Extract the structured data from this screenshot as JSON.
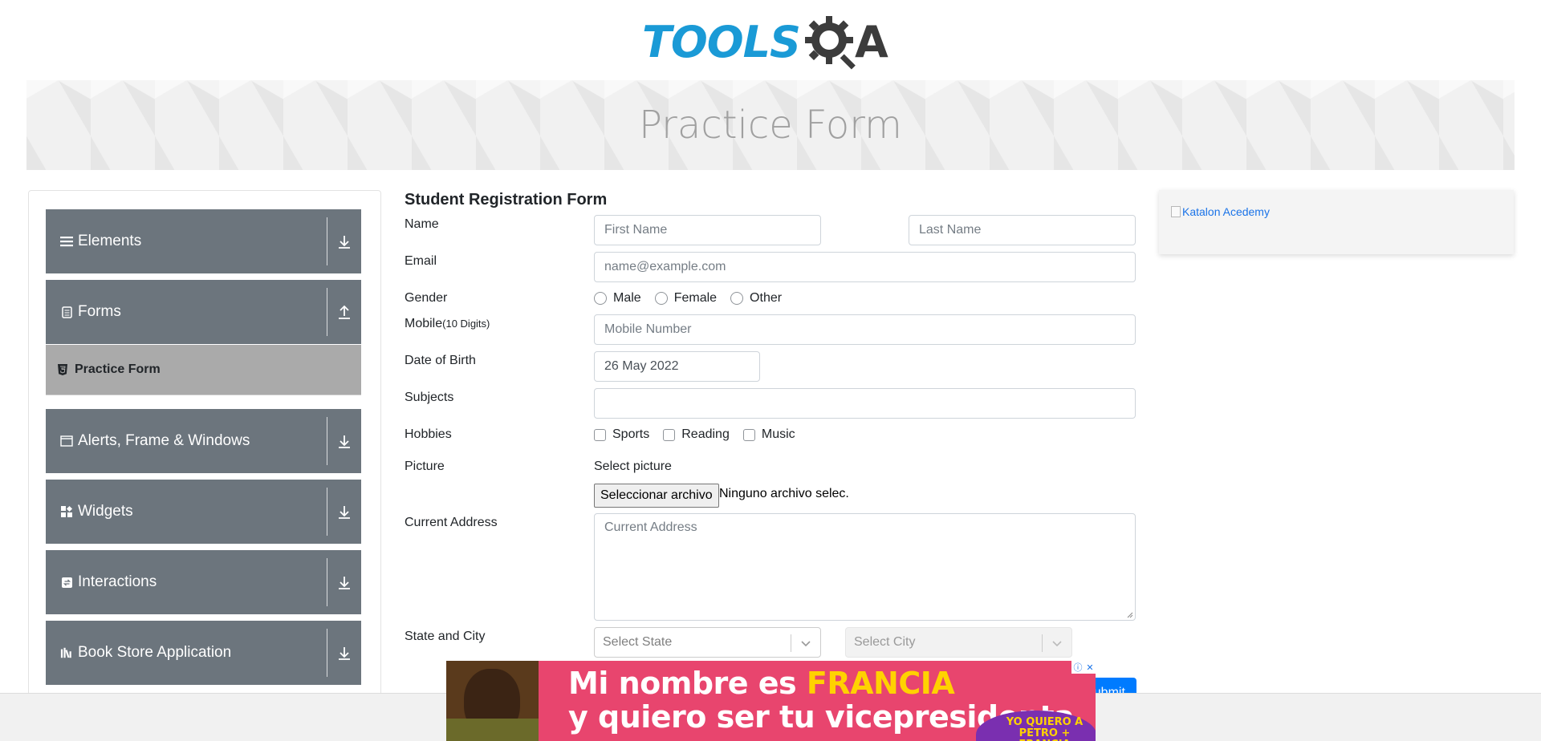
{
  "header": {
    "logo_tools": "TOOLS",
    "logo_q": "Q",
    "logo_a": "A",
    "banner_title": "Practice Form"
  },
  "sidebar": {
    "groups": [
      {
        "label": "Elements",
        "icon": "menu-icon",
        "arrow": "download-icon"
      },
      {
        "label": "Forms",
        "icon": "forms-icon",
        "arrow": "upload-icon"
      },
      {
        "label": "Alerts, Frame & Windows",
        "icon": "window-icon",
        "arrow": "download-icon"
      },
      {
        "label": "Widgets",
        "icon": "widgets-icon",
        "arrow": "download-icon"
      },
      {
        "label": "Interactions",
        "icon": "interactions-icon",
        "arrow": "download-icon"
      },
      {
        "label": "Book Store Application",
        "icon": "books-icon",
        "arrow": "download-icon"
      }
    ],
    "active_item": {
      "label": "Practice Form",
      "icon": "html5-icon"
    }
  },
  "form": {
    "title": "Student Registration Form",
    "name_label": "Name",
    "first_name_placeholder": "First Name",
    "last_name_placeholder": "Last Name",
    "email_label": "Email",
    "email_placeholder": "name@example.com",
    "gender_label": "Gender",
    "gender_options": [
      "Male",
      "Female",
      "Other"
    ],
    "mobile_label": "Mobile",
    "mobile_hint": "(10 Digits)",
    "mobile_placeholder": "Mobile Number",
    "dob_label": "Date of Birth",
    "dob_value": "26 May 2022",
    "subjects_label": "Subjects",
    "hobbies_label": "Hobbies",
    "hobby_options": [
      "Sports",
      "Reading",
      "Music"
    ],
    "picture_label": "Picture",
    "select_picture": "Select picture",
    "file_button": "Seleccionar archivo",
    "file_status": "Ninguno archivo selec.",
    "address_label": "Current Address",
    "address_placeholder": "Current Address",
    "state_city_label": "State and City",
    "state_placeholder": "Select State",
    "city_placeholder": "Select City",
    "submit_label": "Submit"
  },
  "right_ad": {
    "alt_text": "Katalon Acedemy"
  },
  "bottom_ad": {
    "line1_prefix": "Mi nombre es ",
    "line1_highlight": "FRANCIA",
    "line2": "y quiero ser tu vicepresidenta",
    "badge_line1": "YO QUIERO A",
    "badge_line2": "PETRO + FRANCIA",
    "adchoices_i": "ⓘ",
    "adchoices_x": "✕"
  },
  "colors": {
    "sidebar_group": "#6c757d",
    "sidebar_active": "#aaaaaa",
    "logo_blue": "#1a9ad6",
    "primary": "#007bff",
    "ad_pink": "#e8456e"
  }
}
